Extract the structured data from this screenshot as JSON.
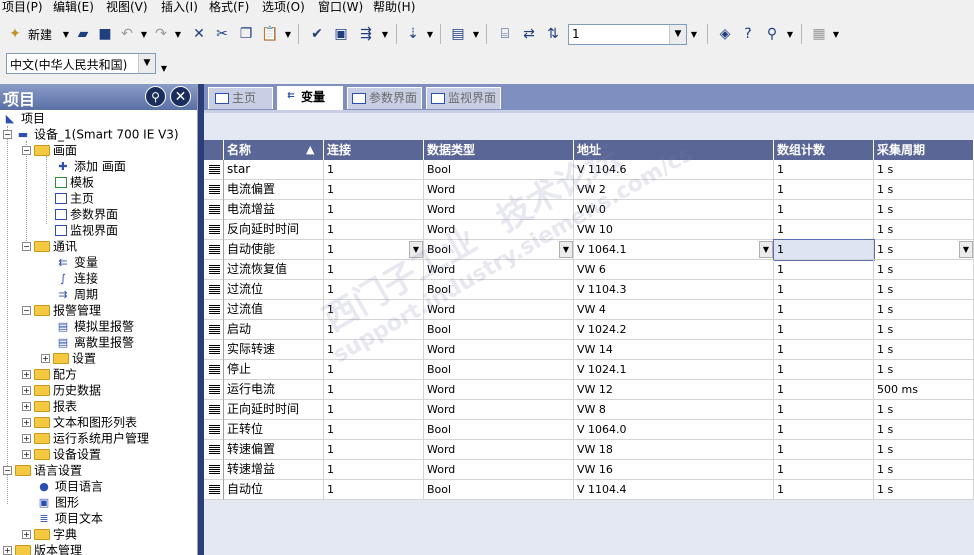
{
  "menu": [
    "项目(P)",
    "编辑(E)",
    "视图(V)",
    "插入(I)",
    "格式(F)",
    "选项(O)",
    "窗口(W)",
    "帮助(H)"
  ],
  "toolbar": {
    "new_label": "新建",
    "zoom_value": "1",
    "language_value": "中文(中华人民共和国)"
  },
  "project": {
    "header": "项目",
    "root": "项目",
    "device": "设备_1(Smart 700 IE V3)",
    "screens": {
      "label": "画面",
      "items": [
        "添加 画面",
        "模板",
        "主页",
        "参数界面",
        "监视界面"
      ]
    },
    "comm": {
      "label": "通讯",
      "items": [
        "变量",
        "连接",
        "周期"
      ]
    },
    "alarm": {
      "label": "报警管理",
      "items": [
        "模拟里报警",
        "离散里报警",
        "设置"
      ]
    },
    "others": [
      "配方",
      "历史数据",
      "报表",
      "文本和图形列表",
      "运行系统用户管理",
      "设备设置"
    ],
    "lang": {
      "label": "语言设置",
      "items": [
        "项目语言",
        "图形",
        "项目文本",
        "字典"
      ]
    },
    "version": "版本管理"
  },
  "tabs": [
    "主页",
    "变量",
    "参数界面",
    "监视界面"
  ],
  "grid": {
    "columns": [
      "名称",
      "连接",
      "数据类型",
      "地址",
      "数组计数",
      "采集周期"
    ],
    "rows": [
      [
        "star",
        "1",
        "Bool",
        "V 1104.6",
        "1",
        "1 s"
      ],
      [
        "电流偏置",
        "1",
        "Word",
        "VW 2",
        "1",
        "1 s"
      ],
      [
        "电流增益",
        "1",
        "Word",
        "VW 0",
        "1",
        "1 s"
      ],
      [
        "反向延时时间",
        "1",
        "Word",
        "VW 10",
        "1",
        "1 s"
      ],
      [
        "自动使能",
        "1",
        "Bool",
        "V 1064.1",
        "1",
        "1 s"
      ],
      [
        "过流恢复值",
        "1",
        "Word",
        "VW 6",
        "1",
        "1 s"
      ],
      [
        "过流位",
        "1",
        "Bool",
        "V 1104.3",
        "1",
        "1 s"
      ],
      [
        "过流值",
        "1",
        "Word",
        "VW 4",
        "1",
        "1 s"
      ],
      [
        "启动",
        "1",
        "Bool",
        "V 1024.2",
        "1",
        "1 s"
      ],
      [
        "实际转速",
        "1",
        "Word",
        "VW 14",
        "1",
        "1 s"
      ],
      [
        "停止",
        "1",
        "Bool",
        "V 1024.1",
        "1",
        "1 s"
      ],
      [
        "运行电流",
        "1",
        "Word",
        "VW 12",
        "1",
        "500 ms"
      ],
      [
        "正向延时时间",
        "1",
        "Word",
        "VW 8",
        "1",
        "1 s"
      ],
      [
        "正转位",
        "1",
        "Bool",
        "V 1064.0",
        "1",
        "1 s"
      ],
      [
        "转速偏置",
        "1",
        "Word",
        "VW 18",
        "1",
        "1 s"
      ],
      [
        "转速增益",
        "1",
        "Word",
        "VW 16",
        "1",
        "1 s"
      ],
      [
        "自动位",
        "1",
        "Bool",
        "V 1104.4",
        "1",
        "1 s"
      ]
    ]
  },
  "watermark": [
    "西门子工业",
    "技术论坛",
    "support.industry.siemens.com/cs"
  ]
}
